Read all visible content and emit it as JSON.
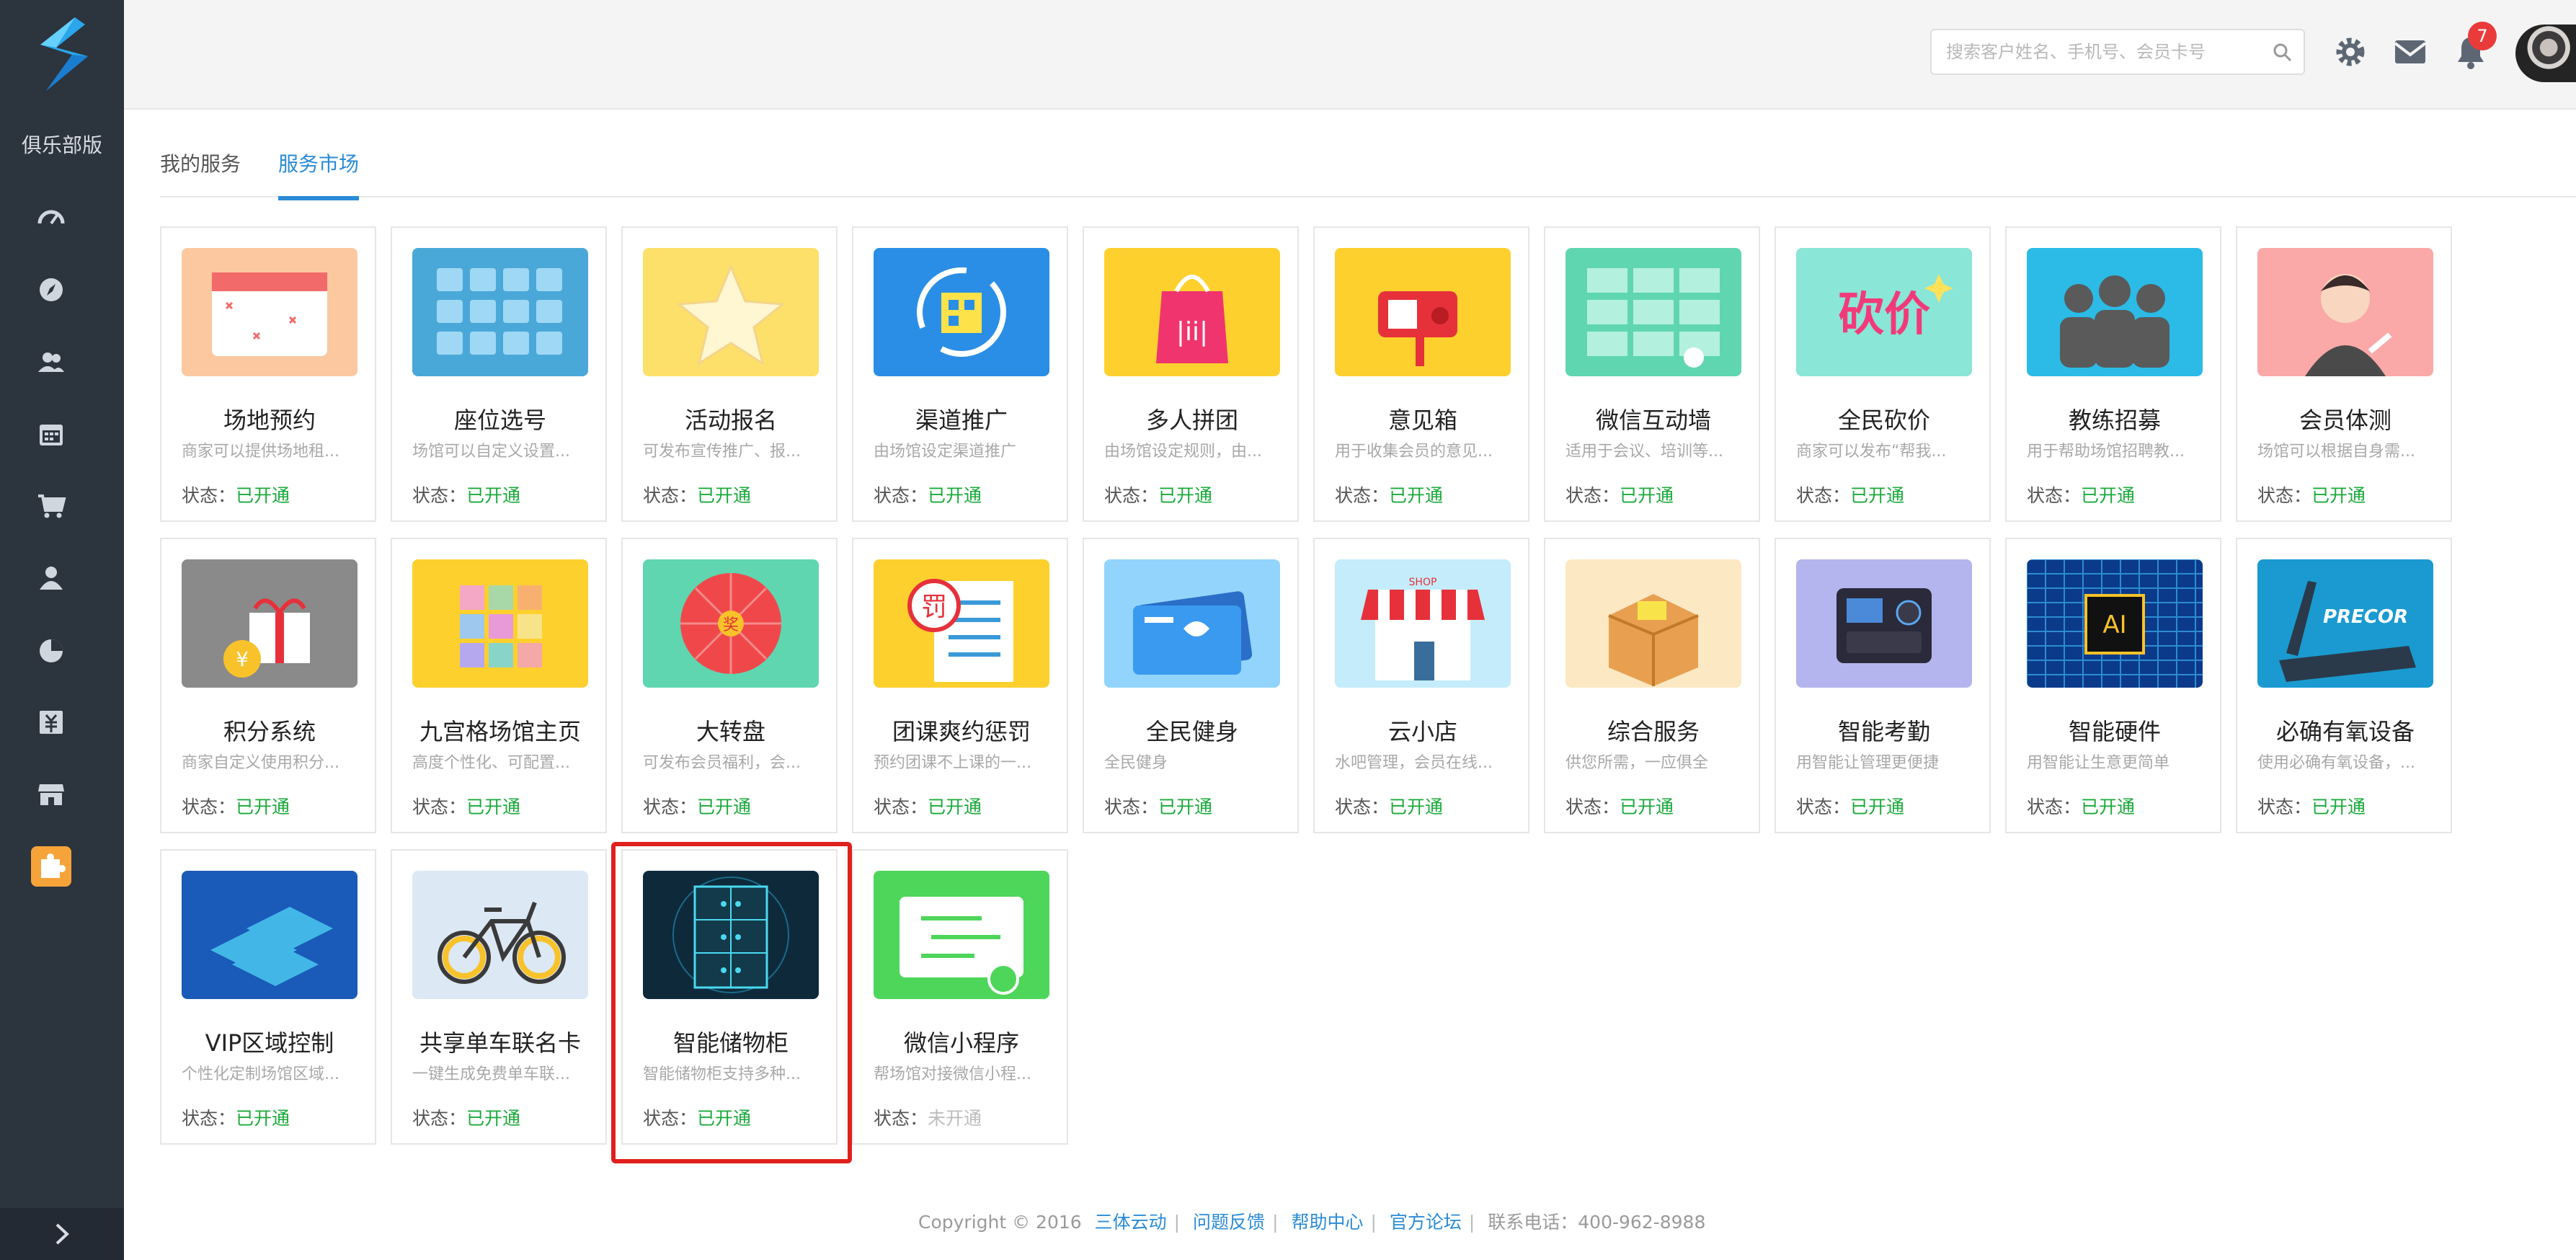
{
  "sidebar": {
    "club_label": "俱乐部版",
    "items": [
      {
        "icon": "dashboard-icon"
      },
      {
        "icon": "compass-icon"
      },
      {
        "icon": "members-icon"
      },
      {
        "icon": "calendar-icon"
      },
      {
        "icon": "cart-icon"
      },
      {
        "icon": "user-icon"
      },
      {
        "icon": "pie-chart-icon"
      },
      {
        "icon": "finance-icon"
      },
      {
        "icon": "store-icon"
      },
      {
        "icon": "puzzle-icon",
        "active": true
      }
    ],
    "expand_icon": "chevron-right-icon"
  },
  "header": {
    "search_placeholder": "搜索客户姓名、手机号、会员卡号",
    "notification_count": "7"
  },
  "tabs": [
    {
      "label": "我的服务",
      "active": false
    },
    {
      "label": "服务市场",
      "active": true
    }
  ],
  "status_label": "状态：",
  "cards": [
    {
      "title": "场地预约",
      "desc": "商家可以提供场地租...",
      "status": "已开通",
      "color": "#fbc8a0"
    },
    {
      "title": "座位选号",
      "desc": "场馆可以自定义设置...",
      "status": "已开通",
      "color": "#4aa8d8"
    },
    {
      "title": "活动报名",
      "desc": "可发布宣传推广、报...",
      "status": "已开通",
      "color": "#fde06a"
    },
    {
      "title": "渠道推广",
      "desc": "由场馆设定渠道推广",
      "status": "已开通",
      "color": "#2a8ee6"
    },
    {
      "title": "多人拼团",
      "desc": "由场馆设定规则，由...",
      "status": "已开通",
      "color": "#fdd02e"
    },
    {
      "title": "意见箱",
      "desc": "用于收集会员的意见...",
      "status": "已开通",
      "color": "#fdd02e"
    },
    {
      "title": "微信互动墙",
      "desc": "适用于会议、培训等...",
      "status": "已开通",
      "color": "#5fd6b0"
    },
    {
      "title": "全民砍价",
      "desc": "商家可以发布“帮我...",
      "status": "已开通",
      "color": "#8ae6d6"
    },
    {
      "title": "教练招募",
      "desc": "用于帮助场馆招聘教...",
      "status": "已开通",
      "color": "#2bbbe6"
    },
    {
      "title": "会员体测",
      "desc": "场馆可以根据自身需...",
      "status": "已开通",
      "color": "#fba8a8"
    },
    {
      "title": "积分系统",
      "desc": "商家自定义使用积分...",
      "status": "已开通",
      "color": "#8a8a8a"
    },
    {
      "title": "九宫格场馆主页",
      "desc": "高度个性化、可配置...",
      "status": "已开通",
      "color": "#fdd02e"
    },
    {
      "title": "大转盘",
      "desc": "可发布会员福利，会...",
      "status": "已开通",
      "color": "#5fd6b0"
    },
    {
      "title": "团课爽约惩罚",
      "desc": "预约团课不上课的一...",
      "status": "已开通",
      "color": "#fdd02e"
    },
    {
      "title": "全民健身",
      "desc": "全民健身",
      "status": "已开通",
      "color": "#92d4fb"
    },
    {
      "title": "云小店",
      "desc": "水吧管理，会员在线...",
      "status": "已开通",
      "color": "#c4ecfb"
    },
    {
      "title": "综合服务",
      "desc": "供您所需，一应俱全",
      "status": "已开通",
      "color": "#fde8c4"
    },
    {
      "title": "智能考勤",
      "desc": "用智能让管理更便捷",
      "status": "已开通",
      "color": "#b4b4ee"
    },
    {
      "title": "智能硬件",
      "desc": "用智能让生意更简单",
      "status": "已开通",
      "color": "#0c3a8a"
    },
    {
      "title": "必确有氧设备",
      "desc": "使用必确有氧设备，...",
      "status": "已开通",
      "color": "#1a9ad0"
    },
    {
      "title": "VIP区域控制",
      "desc": "个性化定制场馆区域...",
      "status": "已开通",
      "color": "#1a5ab8"
    },
    {
      "title": "共享单车联名卡",
      "desc": "一键生成免费单车联...",
      "status": "已开通",
      "color": "#dce8f4"
    },
    {
      "title": "智能储物柜",
      "desc": "智能储物柜支持多种...",
      "status": "已开通",
      "color": "#0e2a3a"
    },
    {
      "title": "微信小程序",
      "desc": "帮场馆对接微信小程...",
      "status": "未开通",
      "color": "#4ed65a"
    }
  ],
  "thumb_text": {
    "ai_chip": "AI",
    "precor": "PRECOR",
    "shop_sign": "SHOP",
    "kanjia": "砍价",
    "wheel_center": "奖",
    "penalty": "罚"
  },
  "footer": {
    "copyright": "Copyright © 2016",
    "links": [
      "三体云动",
      "问题反馈",
      "帮助中心",
      "官方论坛"
    ],
    "phone": "联系电话：400-962-8988"
  }
}
